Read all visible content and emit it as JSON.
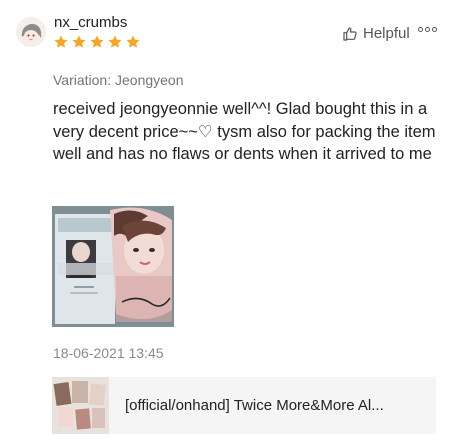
{
  "review": {
    "username": "nx_crumbs",
    "rating": 5,
    "rating_max": 5,
    "star_color": "#f5a623",
    "helpful_label": "Helpful",
    "variation": "Variation: Jeongyeon",
    "text": "received jeongyeonnie well^^! Glad bought this in a very decent price~~♡ tysm also for packing the item well and has no flaws or dents when it arrived to me",
    "timestamp": "18-06-2021 13:45"
  },
  "product": {
    "title": "[official/onhand] Twice More&More Al..."
  },
  "icons": {
    "avatar": "user-avatar",
    "helpful": "thumbs-up-icon",
    "more": "more-options-icon"
  }
}
